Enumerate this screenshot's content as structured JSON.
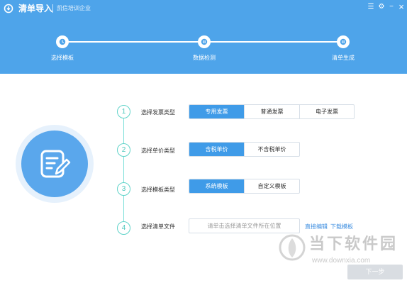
{
  "app": {
    "title": "清单导入",
    "company": "凯信培训企业"
  },
  "window_controls": {
    "menu": "☰",
    "settings": "⚙",
    "minimize": "−",
    "close": "×"
  },
  "steps": [
    {
      "label": "选择模板",
      "state": "current",
      "icon": "clock-icon"
    },
    {
      "label": "数据检测",
      "state": "pending",
      "icon": "pause-icon"
    },
    {
      "label": "清单生成",
      "state": "pending",
      "icon": "pause-icon"
    }
  ],
  "hero": {
    "icon": "edit-document-icon"
  },
  "rows": [
    {
      "number": "1",
      "label": "选择发票类型",
      "options": [
        "专用发票",
        "普通发票",
        "电子发票"
      ],
      "selected": 0
    },
    {
      "number": "2",
      "label": "选择单价类型",
      "options": [
        "含税单价",
        "不含税单价"
      ],
      "selected": 0
    },
    {
      "number": "3",
      "label": "选择模板类型",
      "options": [
        "系统模板",
        "自定义模板"
      ],
      "selected": 0
    },
    {
      "number": "4",
      "label": "选择清单文件"
    }
  ],
  "file": {
    "placeholder": "请单击选择清单文件所在位置",
    "value": ""
  },
  "links": {
    "edit": "直接编辑",
    "download": "下载模板"
  },
  "watermark": {
    "name": "当下软件园",
    "url": "www.downxia.com"
  },
  "next_button": {
    "label": "下一步",
    "enabled": false
  },
  "colors": {
    "header": "#4ea4ea",
    "accent": "#3f9be8",
    "step_number": "#4cc7bc",
    "link": "#3f8fe0"
  }
}
